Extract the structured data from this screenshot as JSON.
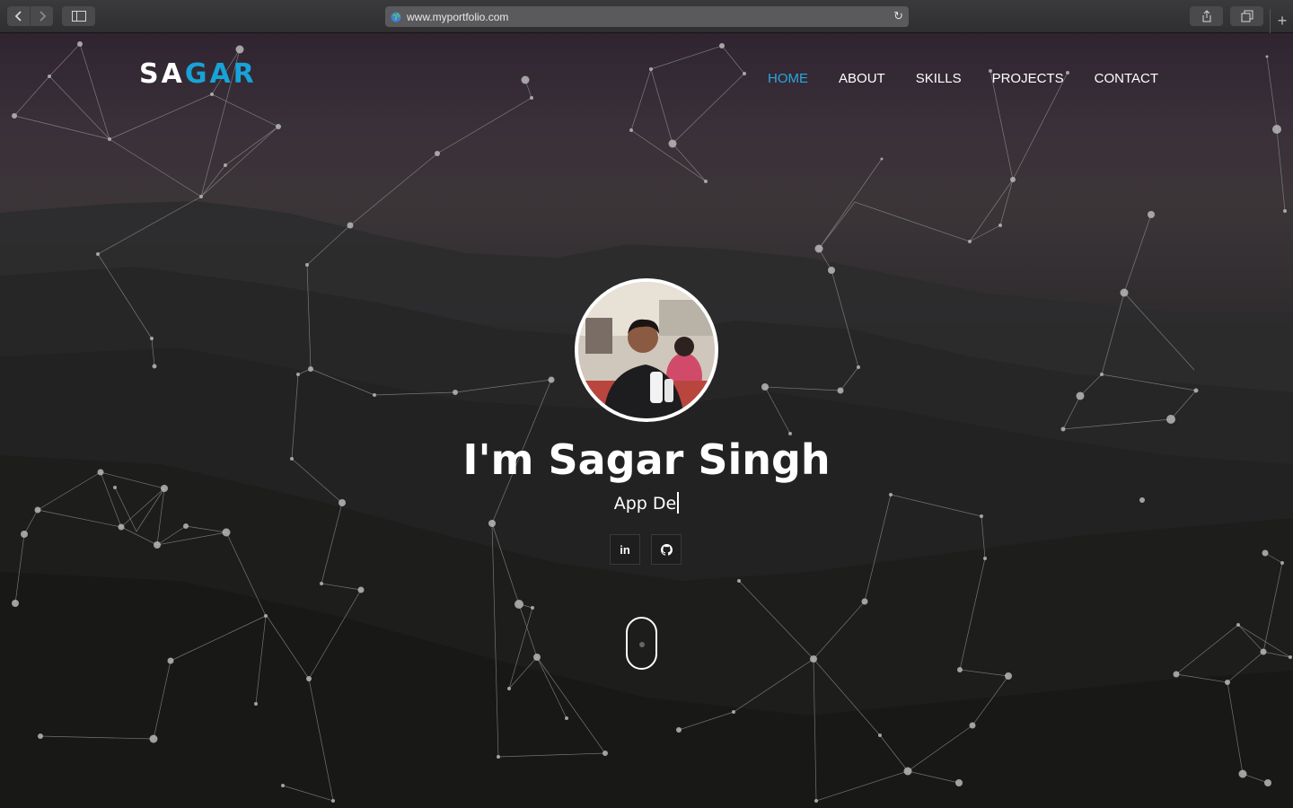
{
  "browser": {
    "url": "www.myportfolio.com",
    "back_icon": "chevron-left-icon",
    "forward_icon": "chevron-right-icon",
    "sidebar_icon": "sidebar-icon",
    "reload_icon": "reload-icon",
    "share_icon": "share-icon",
    "tabs_icon": "tabs-icon",
    "newtab_icon": "plus-icon"
  },
  "header": {
    "logo_part1": "SA",
    "logo_part2": "GAR",
    "nav": [
      {
        "label": "HOME",
        "active": true
      },
      {
        "label": "ABOUT",
        "active": false
      },
      {
        "label": "SKILLS",
        "active": false
      },
      {
        "label": "PROJECTS",
        "active": false
      },
      {
        "label": "CONTACT",
        "active": false
      }
    ]
  },
  "hero": {
    "title": "I'm Sagar Singh",
    "typed_text": "App De",
    "social": [
      {
        "icon": "linkedin-icon",
        "glyph": "in"
      },
      {
        "icon": "github-icon",
        "glyph": "⌂"
      }
    ]
  },
  "colors": {
    "accent": "#18a3d8",
    "nav_active": "#2aa7df",
    "text": "#ffffff"
  }
}
